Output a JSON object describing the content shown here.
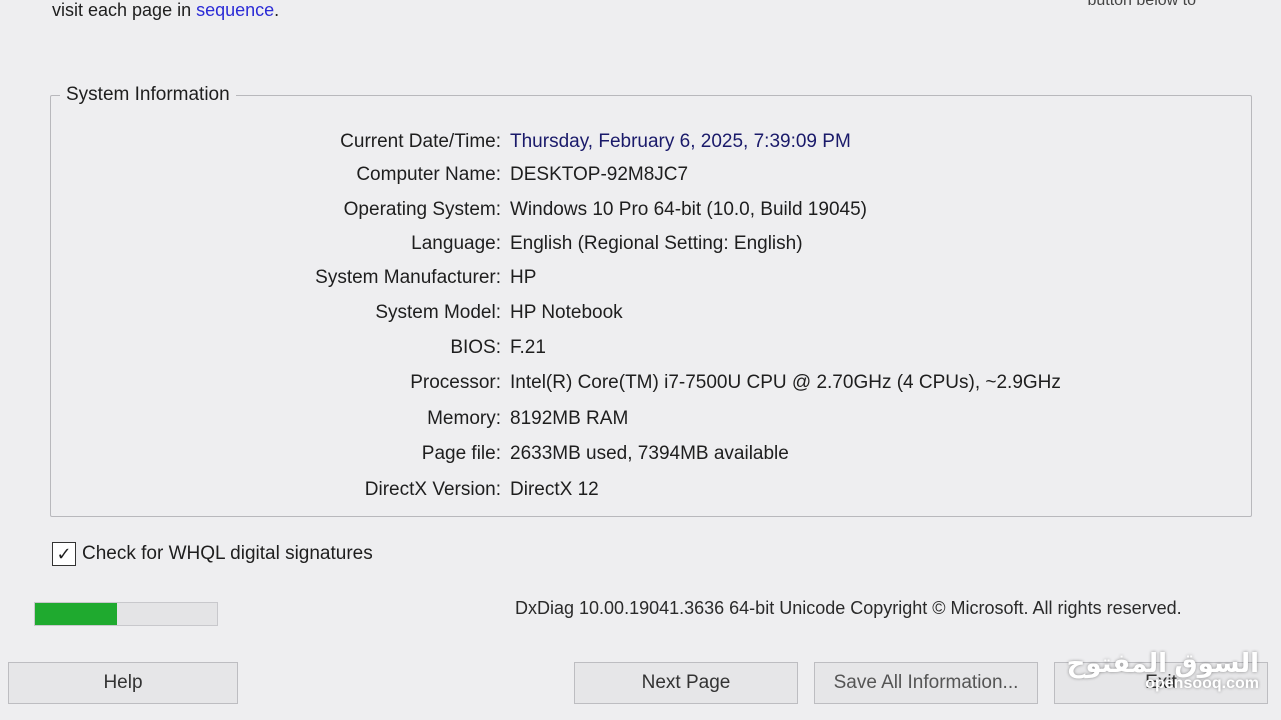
{
  "header": {
    "instruction_prefix": "visit each page in ",
    "instruction_link": "sequence",
    "instruction_suffix": ".",
    "top_right_fragment": "button below to"
  },
  "system_information": {
    "title": "System Information",
    "rows": [
      {
        "label": "Current Date/Time:",
        "value": "Thursday, February 6, 2025, 7:39:09 PM"
      },
      {
        "label": "Computer Name:",
        "value": "DESKTOP-92M8JC7"
      },
      {
        "label": "Operating System:",
        "value": "Windows 10 Pro 64-bit (10.0, Build 19045)"
      },
      {
        "label": "Language:",
        "value": "English (Regional Setting: English)"
      },
      {
        "label": "System Manufacturer:",
        "value": "HP"
      },
      {
        "label": "System Model:",
        "value": "HP Notebook"
      },
      {
        "label": "BIOS:",
        "value": "F.21"
      },
      {
        "label": "Processor:",
        "value": "Intel(R) Core(TM) i7-7500U CPU @ 2.70GHz (4 CPUs), ~2.9GHz"
      },
      {
        "label": "Memory:",
        "value": "8192MB RAM"
      },
      {
        "label": "Page file:",
        "value": "2633MB used, 7394MB available"
      },
      {
        "label": "DirectX Version:",
        "value": "DirectX 12"
      }
    ]
  },
  "whql_checkbox": {
    "label": "Check for WHQL digital signatures",
    "checked": true,
    "check_glyph": "✓"
  },
  "progress": {
    "fraction": 0.45,
    "color": "#1faa2f"
  },
  "footer": {
    "text": "DxDiag 10.00.19041.3636 64-bit Unicode  Copyright © Microsoft. All rights reserved."
  },
  "buttons": {
    "help": "Help",
    "next_page": "Next Page",
    "save_all": "Save All Information...",
    "exit": "Exit"
  },
  "watermark": {
    "arabic": "السوق المفتوح",
    "latin": "opensooq.com"
  }
}
